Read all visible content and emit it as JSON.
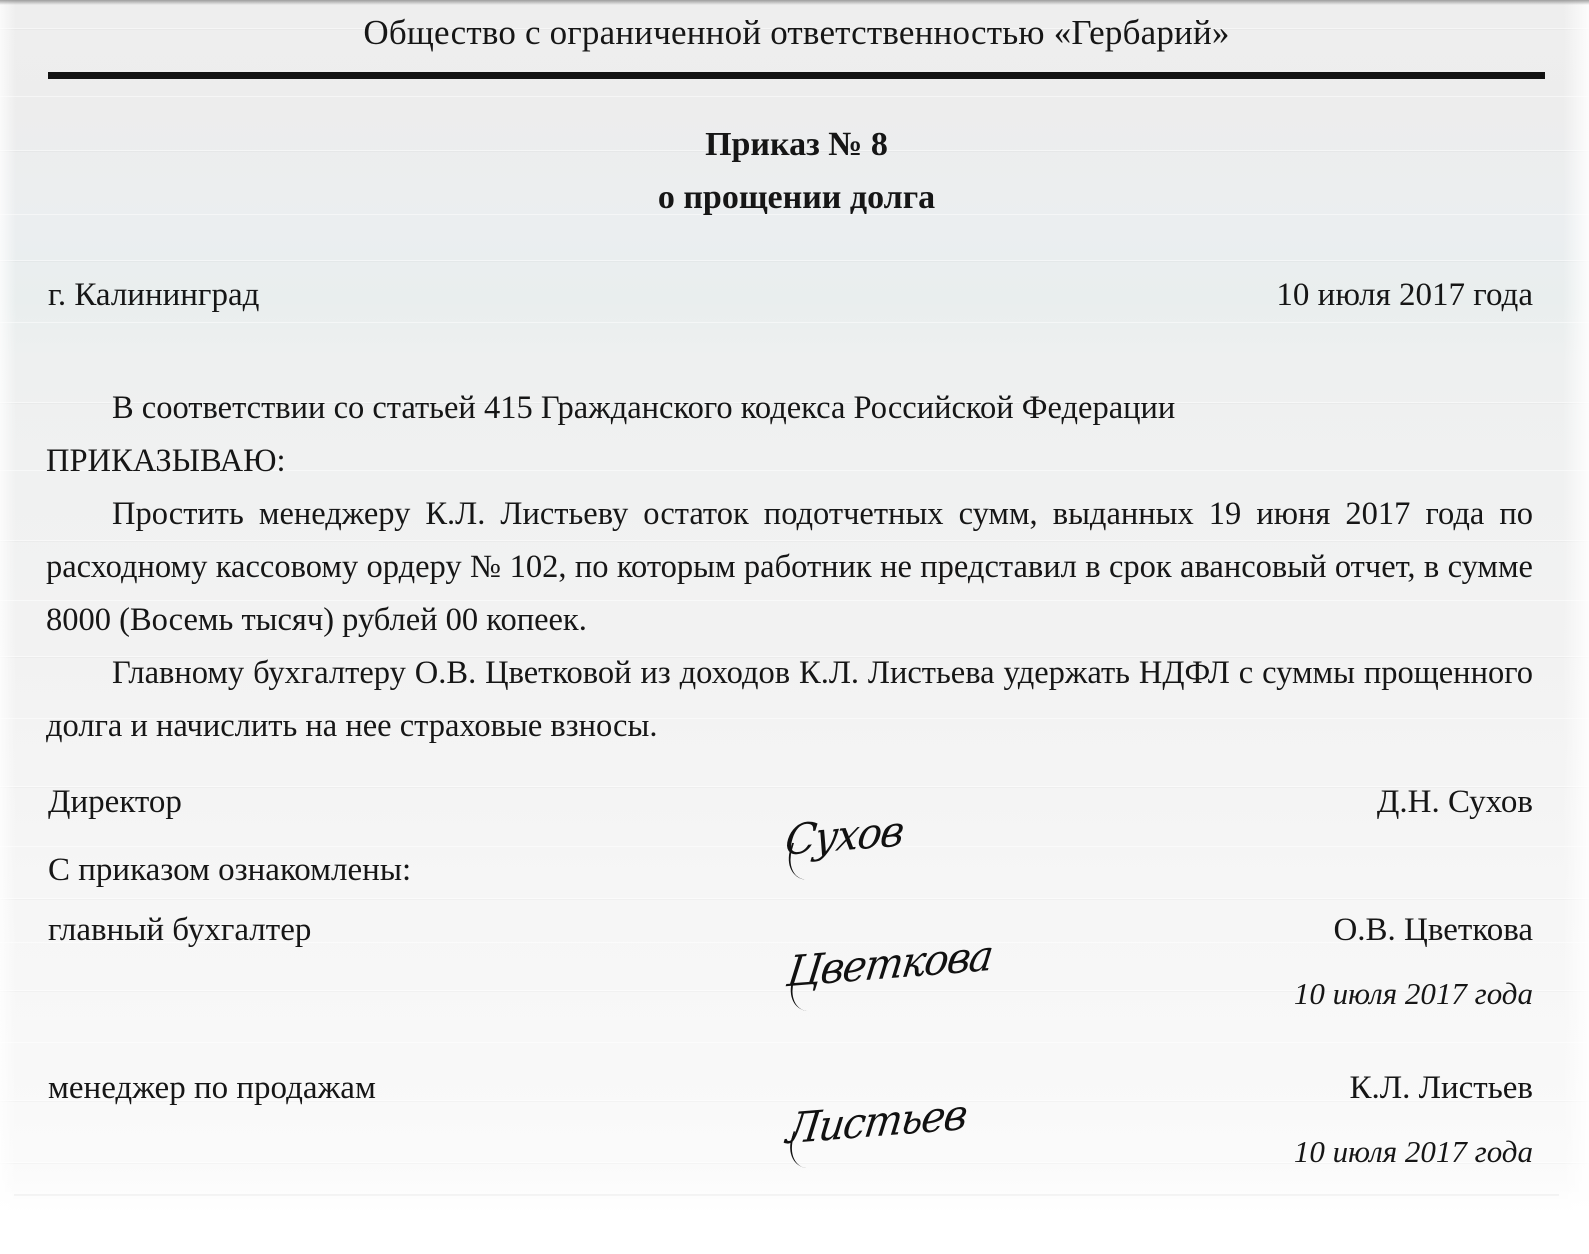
{
  "document": {
    "organization": "Общество с ограниченной ответственностью «Гербарий»",
    "title_line1": "Приказ № 8",
    "title_line2": "о прощении долга",
    "city": "г. Калининград",
    "date": "10 июля 2017 года",
    "paragraphs": {
      "p1": "В соответствии со статьей 415 Гражданского кодекса Российской Федерации",
      "p1_order": "ПРИКАЗЫВАЮ:",
      "p2": "Простить менеджеру К.Л. Листьеву остаток подотчетных сумм, выданных 19 июня 2017 года по расходному кассовому ордеру № 102, по которым работник не представил в срок авансовый отчет, в сумме 8000 (Восемь тысяч) рублей 00 копеек.",
      "p3": "Главному бухгалтеру О.В. Цветковой из доходов К.Л. Листьева удержать НДФЛ с суммы прощенного долга и начислить на нее страховые взносы."
    },
    "signatures": {
      "director": {
        "role": "Директор",
        "signature": "Сухов",
        "name": "Д.Н. Сухов"
      },
      "acknowledge_label": "С приказом ознакомлены:",
      "chief_accountant": {
        "role": "главный бухгалтер",
        "signature": "Цветкова",
        "name": "О.В. Цветкова",
        "date": "10 июля 2017 года"
      },
      "sales_manager": {
        "role": "менеджер по продажам",
        "signature": "Листьев",
        "name": "К.Л. Листьев",
        "date": "10 июля 2017 года"
      }
    }
  },
  "colors": {
    "text": "#161616",
    "rule": "#121212",
    "paper_top": "#eeeeee",
    "paper_tint": "#e9eeee",
    "paper_bottom": "#ffffff"
  }
}
